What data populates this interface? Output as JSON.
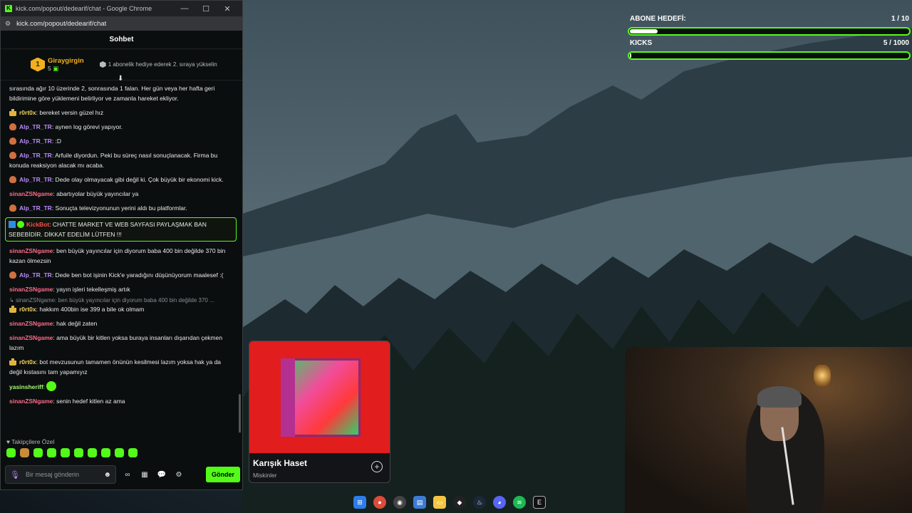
{
  "browser": {
    "window_title": "kick.com/popout/dedearif/chat - Google Chrome",
    "url": "kick.com/popout/dedearif/chat"
  },
  "chat": {
    "header": "Sohbet",
    "top_gifter": {
      "rank": "1",
      "name": "Giraygirgin",
      "count": "5",
      "hint": "1 abonelik hediye ederek 2. sıraya yükselin"
    },
    "messages": [
      {
        "user": "",
        "text": "sırasında ağır 10 üzerinde 2, sonrasında 1 falan. Her gün veya her hafta geri bildirimine göre yüklemeni belirliyor ve zamanla hareket ekliyor."
      },
      {
        "user": "r0rt0x",
        "text": ": bereket versin güzel hız"
      },
      {
        "user": "Alp_TR_TR",
        "text": ": aynen log görevi yapıyor."
      },
      {
        "user": "Alp_TR_TR",
        "text": ": :D"
      },
      {
        "user": "Alp_TR_TR",
        "text": ": Arfuile diyordun. Peki bu süreç nasıl sonuçlanacak. Firma bu konuda reaksiyon alacak mı acaba."
      },
      {
        "user": "Alp_TR_TR",
        "text": ": Dede olay olmayacak gibi değil ki. Çok büyük bir ekonomi kick."
      },
      {
        "user": "sinanZSNgame",
        "text": ": abartıyolar büyük yayıncılar ya"
      },
      {
        "user": "Alp_TR_TR",
        "text": ": Sonuçta televizyonunun yerini aldı bu platformlar."
      },
      {
        "user": "KickBot",
        "text": ": CHATTE MARKET VE WEB SAYFASI PAYLAŞMAK BAN SEBEBİDİR. DİKKAT EDELİM LÜTFEN !!!"
      },
      {
        "user": "sinanZSNgame",
        "text": ": ben büyük yayıncılar için diyorum baba 400 bin değilde 370 bin kazan ölmezsin"
      },
      {
        "user": "Alp_TR_TR",
        "text": ": Dede ben bot işinin Kick'e yaradığını düşünüyorum maalesef :("
      },
      {
        "user": "sinanZSNgame",
        "text": ": yayın işleri tekelleşmiş artık"
      },
      {
        "reply": "sinanZSNgame: ben büyük yayıncılar için diyorum baba 400 bin değilde 370 ..."
      },
      {
        "user": "r0rt0x",
        "text": ": hakkım 400bin ise 399 a bile ok olmam"
      },
      {
        "user": "sinanZSNgame",
        "text": ": hak değil zaten"
      },
      {
        "user": "sinanZSNgame",
        "text": ": ama büyük bir kitlen yoksa buraya insanları dışarıdan çekmen lazım"
      },
      {
        "user": "r0rt0x",
        "text": ": bot mevzusunun tamamen önünün kesilmesi lazım yoksa hak ya da değil kıstasını tam yapamıyız"
      },
      {
        "user": "yasinsheriff",
        "text": ":"
      },
      {
        "user": "sinanZSNgame",
        "text": ": senin hedef kitlen az ama"
      }
    ],
    "emote_row_label": "Takipçilere Özel",
    "input_placeholder": "Bir mesaj gönderin",
    "send_label": "Gönder"
  },
  "overlay": {
    "sub_goal": {
      "label": "ABONE HEDEFİ:",
      "value": "1 / 10",
      "progress": 0.1
    },
    "kicks_goal": {
      "label": "KICKS",
      "value": "5 / 1000",
      "progress": 0.005
    }
  },
  "music": {
    "title": "Karışık Haset",
    "artist": "Miskinler"
  },
  "colors": {
    "kick_green": "#53fc18",
    "album_red": "#e11d1d"
  }
}
